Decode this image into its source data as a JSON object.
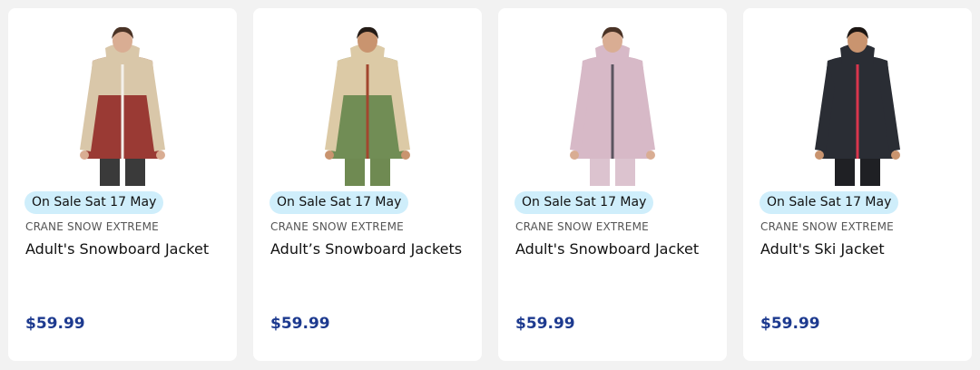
{
  "products": [
    {
      "badge": "On Sale Sat 17 May",
      "brand": "CRANE SNOW EXTREME",
      "title": "Adult's Snowboard Jacket",
      "price": "$59.99",
      "image": "woman-jacket-red-beige",
      "colors": {
        "body": "#9a3a34",
        "yoke": "#d9c7a9",
        "skin": "#d9ad93",
        "hair": "#4a3326",
        "pants": "#3a3a3a",
        "zip": "#f4f0ea"
      }
    },
    {
      "badge": "On Sale Sat 17 May",
      "brand": "CRANE SNOW EXTREME",
      "title": "Adult’s Snowboard Jackets",
      "price": "$59.99",
      "image": "man-jacket-green-beige",
      "colors": {
        "body": "#718d55",
        "yoke": "#dccaa6",
        "skin": "#c9946f",
        "hair": "#241b16",
        "pants": "#6f8a52",
        "zip": "#a2472f"
      }
    },
    {
      "badge": "On Sale Sat 17 May",
      "brand": "CRANE SNOW EXTREME",
      "title": "Adult's Snowboard Jacket",
      "price": "$59.99",
      "image": "woman-jacket-lilac",
      "colors": {
        "body": "#d7b9c7",
        "yoke": "#d7b9c7",
        "skin": "#d9ad93",
        "hair": "#4a3326",
        "pants": "#dcc3cf",
        "zip": "#5b5560"
      }
    },
    {
      "badge": "On Sale Sat 17 May",
      "brand": "CRANE SNOW EXTREME",
      "title": "Adult's Ski Jacket",
      "price": "$59.99",
      "image": "man-jacket-black",
      "colors": {
        "body": "#2a2d34",
        "yoke": "#2a2d34",
        "skin": "#c9946f",
        "hair": "#1c1613",
        "pants": "#1f2024",
        "zip": "#d9354d"
      }
    }
  ]
}
